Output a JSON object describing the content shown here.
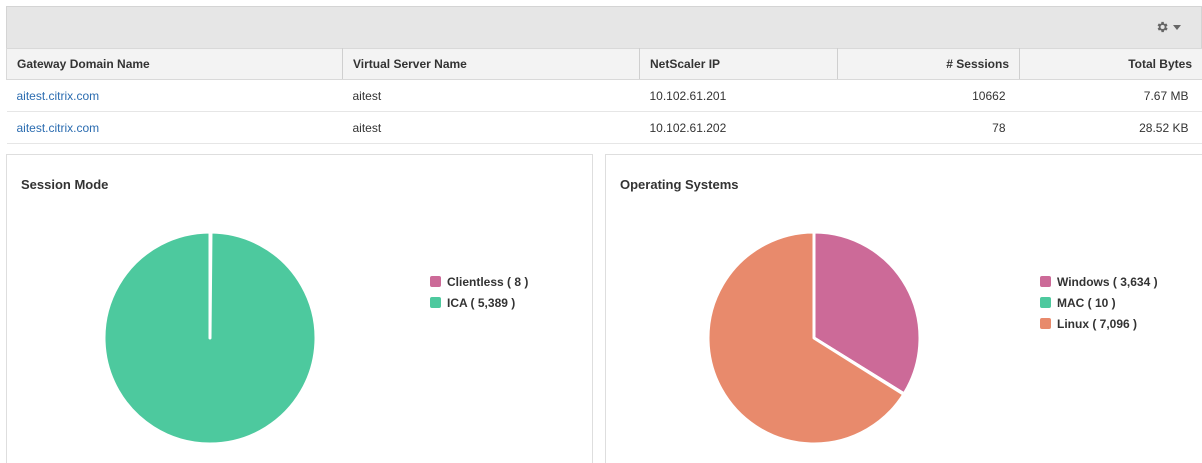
{
  "toolbar": {
    "settings_icon": "gear-icon",
    "dropdown_icon": "caret-down-icon"
  },
  "table": {
    "headers": [
      "Gateway Domain Name",
      "Virtual Server Name",
      "NetScaler IP",
      "# Sessions",
      "Total Bytes"
    ],
    "rows": [
      [
        "aitest.citrix.com",
        "aitest",
        "10.102.61.201",
        "10662",
        "7.67 MB"
      ],
      [
        "aitest.citrix.com",
        "aitest",
        "10.102.61.202",
        "78",
        "28.52 KB"
      ]
    ]
  },
  "session_mode": {
    "title": "Session Mode",
    "legend": [
      "Clientless ( 8 )",
      "ICA ( 5,389 )"
    ]
  },
  "operating_systems": {
    "title": "Operating Systems",
    "legend": [
      "Windows ( 3,634 )",
      "MAC ( 10 )",
      "Linux ( 7,096 )"
    ]
  },
  "colors": {
    "pink": "#cc6a98",
    "green": "#4dc99e",
    "orange": "#e88a6c"
  },
  "chart_data": [
    {
      "type": "pie",
      "title": "Session Mode",
      "categories": [
        "Clientless",
        "ICA"
      ],
      "values": [
        8,
        5389
      ],
      "colors": [
        "#cc6a98",
        "#4dc99e"
      ],
      "legend_position": "right"
    },
    {
      "type": "pie",
      "title": "Operating Systems",
      "categories": [
        "Windows",
        "MAC",
        "Linux"
      ],
      "values": [
        3634,
        10,
        7096
      ],
      "colors": [
        "#cc6a98",
        "#4dc99e",
        "#e88a6c"
      ],
      "legend_position": "right"
    }
  ]
}
